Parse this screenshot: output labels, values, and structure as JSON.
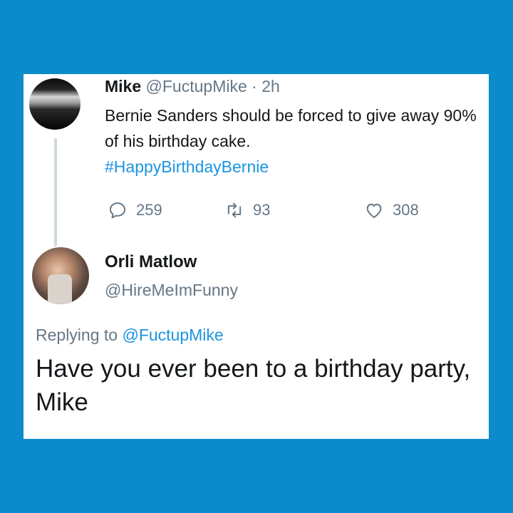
{
  "tweet": {
    "name": "Mike",
    "handle": "@FuctupMike",
    "separator": "·",
    "time": "2h",
    "text": "Bernie Sanders should be forced to give away 90% of his birthday cake.",
    "hashtag": "#HappyBirthdayBernie",
    "replies": "259",
    "retweets": "93",
    "likes": "308"
  },
  "reply": {
    "name": "Orli Matlow",
    "handle": "@HireMeImFunny",
    "replying_prefix": "Replying to",
    "replying_to": "@FuctupMike",
    "text": "Have you ever been to a birthday party, Mike"
  },
  "colors": {
    "background": "#0b8bcb",
    "link": "#1b95e0",
    "muted": "#657786"
  }
}
